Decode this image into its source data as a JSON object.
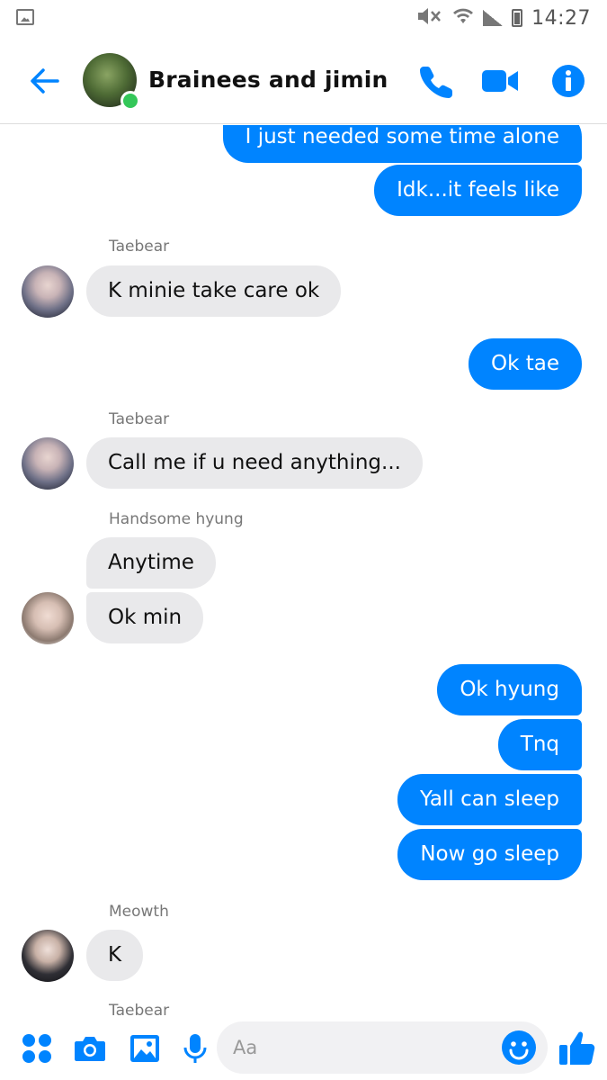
{
  "status_bar": {
    "time": "14:27",
    "icons": [
      "gallery-icon",
      "mute-icon",
      "wifi-icon",
      "signal-icon",
      "battery-icon"
    ]
  },
  "header": {
    "title": "Brainees and jimin",
    "online": true,
    "icons": [
      "back-arrow-icon",
      "phone-icon",
      "video-icon",
      "info-icon"
    ]
  },
  "messages": [
    {
      "direction": "out",
      "text": "I just needed some time alone"
    },
    {
      "direction": "out",
      "text": "Idk...it feels like"
    },
    {
      "direction": "in",
      "sender": "Taebear",
      "text": "K minie take care ok"
    },
    {
      "direction": "out",
      "text": "Ok tae"
    },
    {
      "direction": "in",
      "sender": "Taebear",
      "text": "Call me if u need anything..."
    },
    {
      "direction": "in",
      "sender": "Handsome hyung",
      "text": "Anytime"
    },
    {
      "direction": "in",
      "sender": "Handsome hyung",
      "text": "Ok min"
    },
    {
      "direction": "out",
      "text": "Ok hyung"
    },
    {
      "direction": "out",
      "text": "Tnq"
    },
    {
      "direction": "out",
      "text": "Yall can sleep"
    },
    {
      "direction": "out",
      "text": "Now go sleep"
    },
    {
      "direction": "in",
      "sender": "Meowth",
      "text": "K"
    },
    {
      "direction": "in",
      "sender": "Taebear",
      "text": ""
    }
  ],
  "composer": {
    "placeholder": "Aa",
    "value": "",
    "icons": [
      "apps-icon",
      "camera-icon",
      "gallery-icon",
      "microphone-icon",
      "emoji-icon",
      "thumbs-up-icon"
    ]
  },
  "colors": {
    "accent": "#0084ff",
    "incoming_bubble": "#e9e9eb",
    "online": "#34c759"
  }
}
